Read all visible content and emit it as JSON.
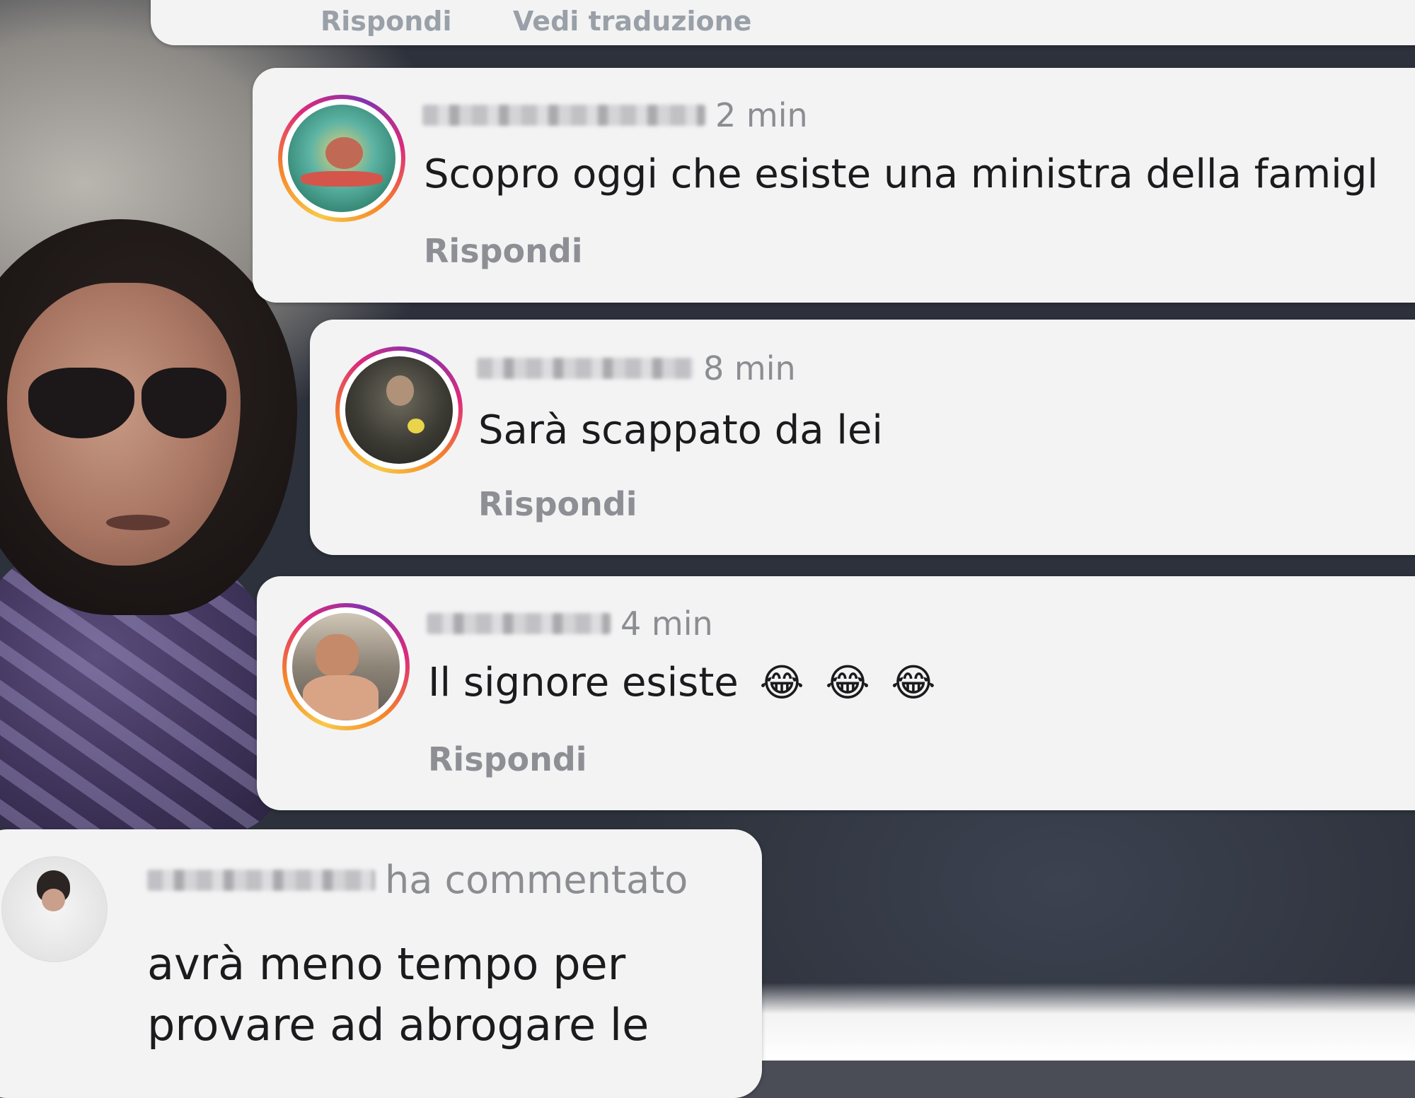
{
  "top_card": {
    "reply_label": "Rispondi",
    "translation_label": "Vedi traduzione"
  },
  "comments": [
    {
      "time": "2 min",
      "text": "Scopro oggi che esiste una ministra della famigl",
      "reply_label": "Rispondi"
    },
    {
      "time": "8 min",
      "text": "Sarà scappato da lei",
      "reply_label": "Rispondi"
    },
    {
      "time": "4 min",
      "text": "Il signore esiste",
      "emojis": [
        "😂",
        "😂",
        "😂"
      ],
      "reply_label": "Rispondi"
    }
  ],
  "notification": {
    "action": "ha commentato",
    "text": "avrà meno tempo per provare ad abrogare le"
  },
  "icons": {
    "avatar_ring": "story-ring-gradient",
    "emoji": "face-with-tears-of-joy-emoji"
  },
  "colors": {
    "card_background": "#f3f3f4",
    "meta_text": "#8c8d91",
    "body_text": "#1b1b1d"
  }
}
